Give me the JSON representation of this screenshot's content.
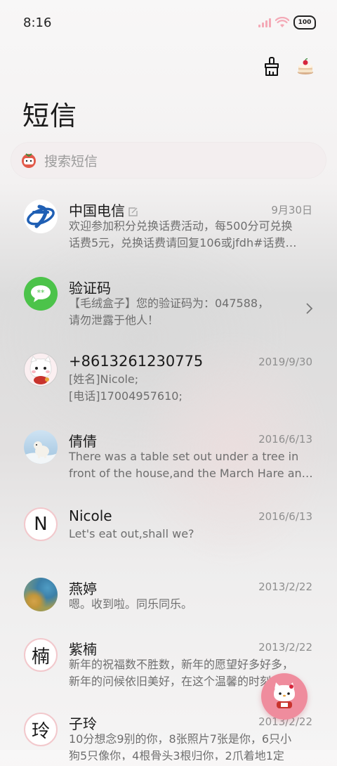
{
  "status_bar": {
    "time": "8:16",
    "battery": "100"
  },
  "header": {
    "title": "短信",
    "actions": [
      {
        "icon": "brush-icon"
      },
      {
        "icon": "cake-icon"
      }
    ]
  },
  "search": {
    "placeholder": "搜索短信"
  },
  "messages": [
    {
      "name": "中国电信",
      "date": "9月30日",
      "line1": "欢迎参加积分兑换话费活动，每500分可兑换",
      "line2": "话费5元，兑换话费请回复106或jfdh#话费…",
      "avatar": "china-telecom-logo"
    },
    {
      "name": "验证码",
      "date": "",
      "line1": "【毛绒盒子】您的验证码为：047588，",
      "line2": "请勿泄露于他人！",
      "avatar": "message-bubble-icon"
    },
    {
      "name": "+8613261230775",
      "date": "2019/9/30",
      "line1": "[姓名]Nicole;",
      "line2": "[电话]17004957610;",
      "avatar": "cartoon-cat-avatar"
    },
    {
      "name": "倩倩",
      "date": "2016/6/13",
      "line1": "There was a table set out under a tree in",
      "line2": "front of the house,and the March Hare an…",
      "avatar": "polar-bear-avatar"
    },
    {
      "name": "Nicole",
      "date": "2016/6/13",
      "line1": "Let's eat out,shall we?",
      "line2": "",
      "avatar": "N"
    },
    {
      "name": "燕婷",
      "date": "2013/2/22",
      "line1": "嗯。收到啦。同乐同乐。",
      "line2": "",
      "avatar": "landscape-photo-avatar"
    },
    {
      "name": "紫楠",
      "date": "2013/2/22",
      "line1": "新年的祝福数不胜数，新年的愿望好多好多，",
      "line2": "新年的问候依旧美好，在这个温馨的时刻，…",
      "avatar": "楠"
    },
    {
      "name": "子玲",
      "date": "2013/2/22",
      "line1": "10分想念9别的你，8张照片7张是你，6只小",
      "line2": "狗5只像你，4根骨头3根归你，2爪着地1定",
      "avatar": "玲"
    }
  ],
  "fab": {
    "icon": "compose-cat-icon"
  },
  "colors": {
    "accent": "#ef8c9d",
    "telecom_blue": "#1f5fb4",
    "sms_green": "#4cc34a"
  }
}
